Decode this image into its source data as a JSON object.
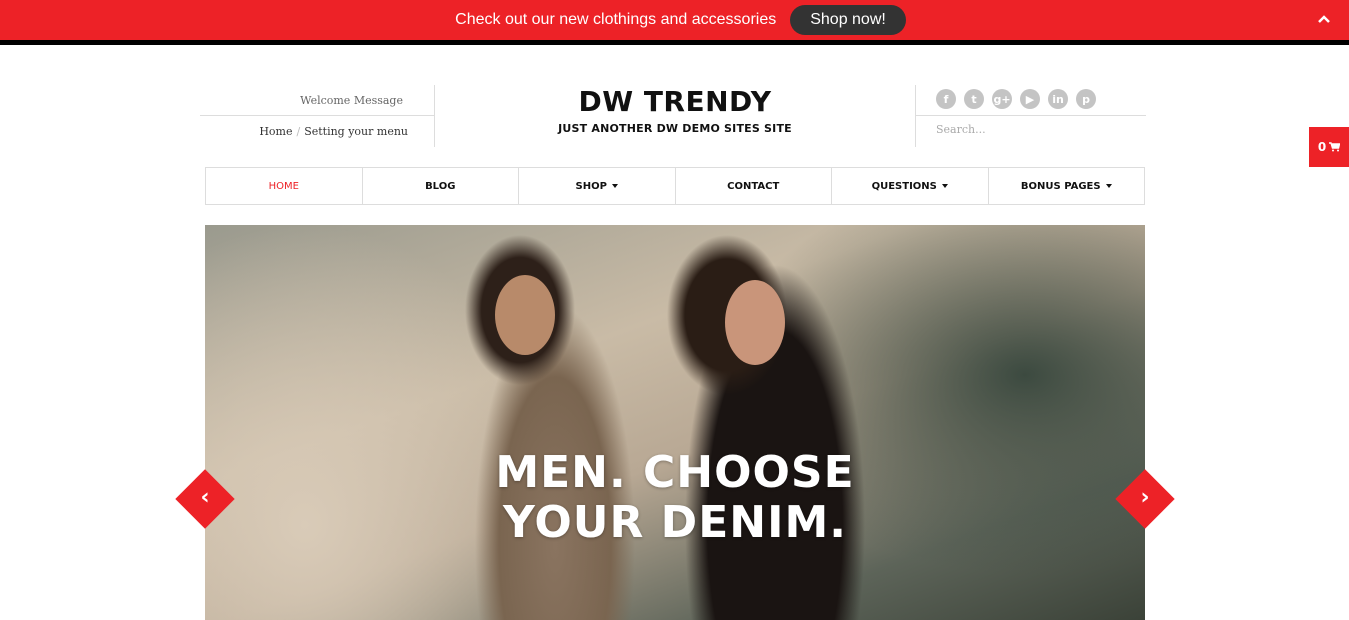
{
  "promo": {
    "message": "Check out our new clothings and accessories",
    "button_label": "Shop now!",
    "collapse_icon": "chevron-up-icon"
  },
  "header": {
    "welcome": "Welcome Message",
    "breadcrumb": [
      "Home",
      "Setting your menu"
    ],
    "breadcrumb_sep": "/",
    "site_title": "DW TRENDY",
    "tagline": "JUST ANOTHER DW DEMO SITES SITE",
    "social": [
      {
        "name": "facebook-icon",
        "glyph": "f"
      },
      {
        "name": "twitter-icon",
        "glyph": "t"
      },
      {
        "name": "google-plus-icon",
        "glyph": "g+"
      },
      {
        "name": "youtube-icon",
        "glyph": "▶"
      },
      {
        "name": "linkedin-icon",
        "glyph": "in"
      },
      {
        "name": "pinterest-icon",
        "glyph": "p"
      }
    ],
    "search_placeholder": "Search..."
  },
  "cart": {
    "count": "0",
    "icon": "cart-icon"
  },
  "nav": {
    "items": [
      {
        "label": "HOME",
        "active": true,
        "dropdown": false
      },
      {
        "label": "BLOG",
        "active": false,
        "dropdown": false
      },
      {
        "label": "SHOP",
        "active": false,
        "dropdown": true
      },
      {
        "label": "CONTACT",
        "active": false,
        "dropdown": false
      },
      {
        "label": "QUESTIONS",
        "active": false,
        "dropdown": true
      },
      {
        "label": "BONUS PAGES",
        "active": false,
        "dropdown": true
      }
    ]
  },
  "slider": {
    "caption_line1": "MEN. CHOOSE",
    "caption_line2": "YOUR DENIM.",
    "prev_glyph": "‹",
    "next_glyph": "›"
  },
  "colors": {
    "accent": "#ed2227",
    "dark_button": "#333333",
    "border": "#dddddd"
  }
}
